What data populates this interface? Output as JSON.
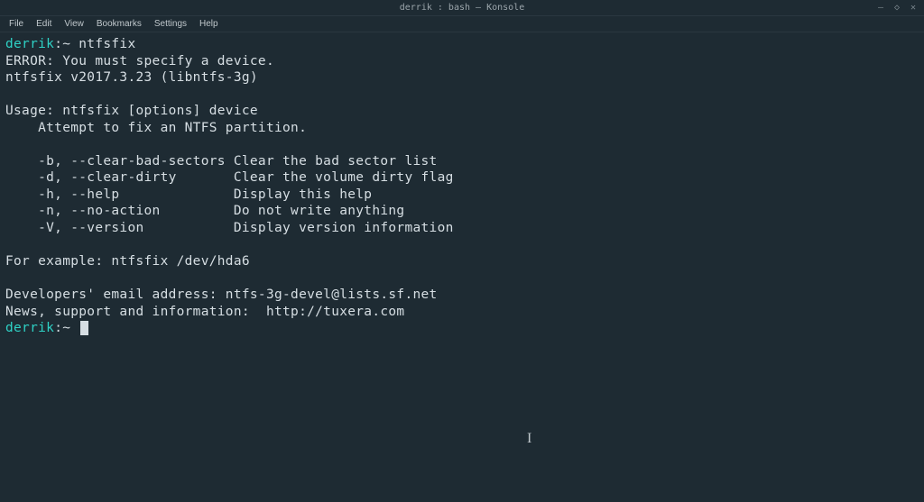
{
  "titlebar": {
    "title": "derrik : bash — Konsole"
  },
  "windowControls": {
    "min": "–",
    "max": "◇",
    "close": "✕"
  },
  "menu": {
    "file": "File",
    "edit": "Edit",
    "view": "View",
    "bookmarks": "Bookmarks",
    "settings": "Settings",
    "help": "Help"
  },
  "prompt": {
    "user": "derrik",
    "sep": ":",
    "path": "~",
    "sym": " "
  },
  "cmd1": "ntfsfix",
  "out": {
    "l1": "ERROR: You must specify a device.",
    "l2": "ntfsfix v2017.3.23 (libntfs-3g)",
    "l3": "",
    "l4": "Usage: ntfsfix [options] device",
    "l5": "    Attempt to fix an NTFS partition.",
    "l6": "",
    "l7": "    -b, --clear-bad-sectors Clear the bad sector list",
    "l8": "    -d, --clear-dirty       Clear the volume dirty flag",
    "l9": "    -h, --help              Display this help",
    "l10": "    -n, --no-action         Do not write anything",
    "l11": "    -V, --version           Display version information",
    "l12": "",
    "l13": "For example: ntfsfix /dev/hda6",
    "l14": "",
    "l15": "Developers' email address: ntfs-3g-devel@lists.sf.net",
    "l16": "News, support and information:  http://tuxera.com"
  }
}
